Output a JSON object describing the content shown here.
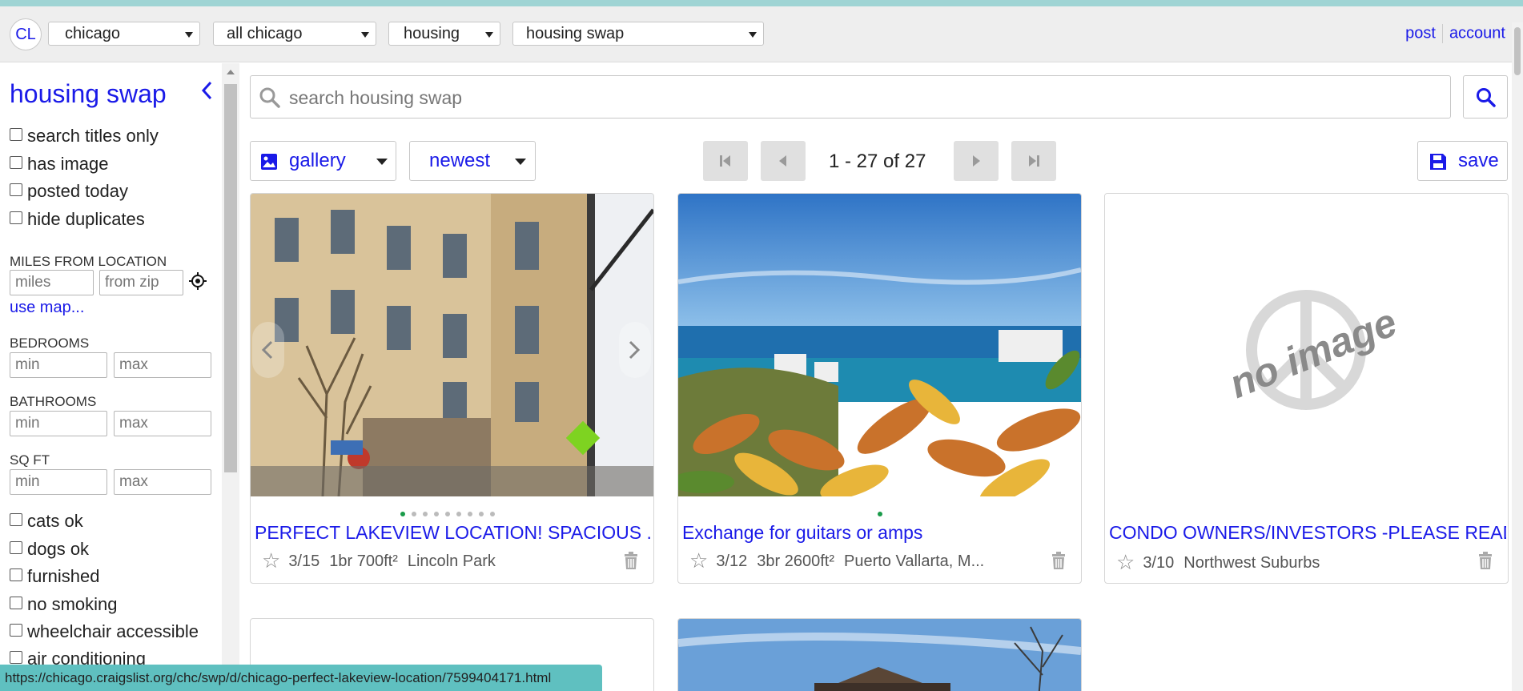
{
  "header": {
    "logo": "CL",
    "dropdowns": [
      {
        "value": "chicago"
      },
      {
        "value": "all chicago"
      },
      {
        "value": "housing"
      },
      {
        "value": "housing swap"
      }
    ],
    "links": {
      "post": "post",
      "account": "account"
    }
  },
  "sidebar": {
    "title": "housing swap",
    "top_checks": [
      "search titles only",
      "has image",
      "posted today",
      "hide duplicates"
    ],
    "miles_label": "MILES FROM LOCATION",
    "miles_placeholder": "miles",
    "zip_placeholder": "from zip",
    "use_map": "use map...",
    "bedrooms_label": "BEDROOMS",
    "bathrooms_label": "BATHROOMS",
    "sqft_label": "SQ FT",
    "min_placeholder": "min",
    "max_placeholder": "max",
    "attr_checks": [
      "cats ok",
      "dogs ok",
      "furnished",
      "no smoking",
      "wheelchair accessible",
      "air conditioning"
    ]
  },
  "main": {
    "search_placeholder": "search housing swap",
    "view_label": "gallery",
    "sort_label": "newest",
    "pagination": "1 - 27 of 27",
    "save_label": "save"
  },
  "listings": [
    {
      "title": "PERFECT LAKEVIEW LOCATION! SPACIOUS ...",
      "date": "3/15",
      "size": "1br 700ft²",
      "location": "Lincoln Park"
    },
    {
      "title": "Exchange for guitars or amps",
      "date": "3/12",
      "size": "3br 2600ft²",
      "location": "Puerto Vallarta, M..."
    },
    {
      "title": "CONDO OWNERS/INVESTORS -PLEASE READ",
      "date": "3/10",
      "size": "",
      "location": "Northwest Suburbs",
      "no_image_text": "no image"
    }
  ],
  "status_url": "https://chicago.craigslist.org/chc/swp/d/chicago-perfect-lakeview-location/7599404171.html",
  "colors": {
    "link": "#1a1ae8",
    "topbar": "#eeeeee",
    "statusbar": "#5fc0c0",
    "dot_active": "#1a9b4a"
  }
}
